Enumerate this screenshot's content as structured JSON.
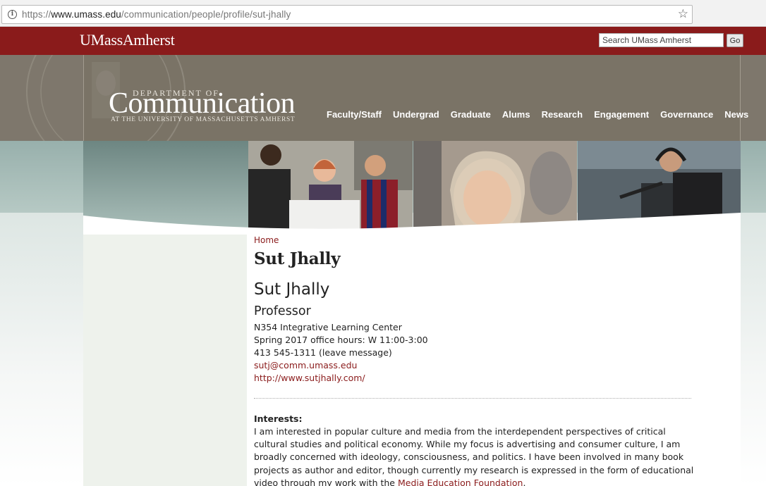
{
  "browser": {
    "url_prefix": "https://",
    "url_host": "www.umass.edu",
    "url_path": "/communication/people/profile/sut-jhally"
  },
  "top_bar": {
    "logo": "UMassAmherst",
    "search_placeholder": "Search UMass Amherst",
    "go_label": "Go"
  },
  "header": {
    "dept_of": "DEPARTMENT OF",
    "dept_name": "Communication",
    "dept_sub": "AT THE UNIVERSITY OF MASSACHUSETTS AMHERST",
    "nav": [
      "Faculty/Staff",
      "Undergrad",
      "Graduate",
      "Alums",
      "Research",
      "Engagement",
      "Governance",
      "News"
    ]
  },
  "colors": {
    "brand": "#8a1b1b",
    "header": "#7a7366"
  },
  "content": {
    "breadcrumb": "Home",
    "page_title": "Sut Jhally",
    "name": "Sut Jhally",
    "role": "Professor",
    "office": "N354 Integrative Learning Center",
    "hours": "Spring 2017 office hours: W 11:00-3:00",
    "phone": "413 545-1311 (leave message)",
    "email": "sutj@comm.umass.edu",
    "website": "http://www.sutjhally.com/",
    "interests_label": "Interests:",
    "interests_text": "I am interested in popular culture and media from the interdependent perspectives of critical cultural studies and political economy.  While my focus is advertising and consumer culture, I am broadly concerned with ideology, consciousness, and politics.  I have been involved in many book projects as author and editor, though currently my research is expressed in the form of educational video through my work with the ",
    "interests_link": "Media Education Foundation",
    "interests_end": "."
  }
}
